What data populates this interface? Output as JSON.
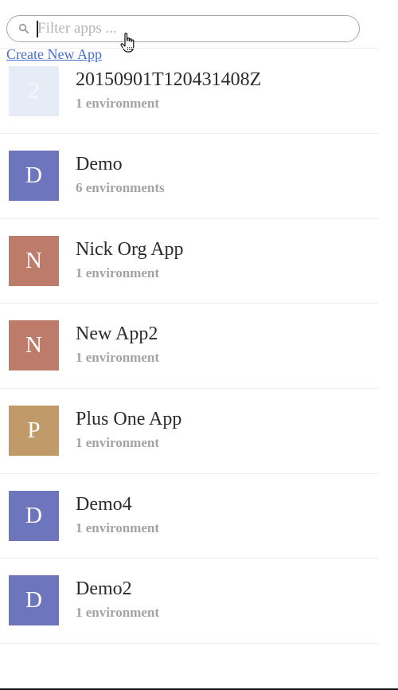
{
  "search": {
    "placeholder": "Filter apps ...",
    "value": ""
  },
  "create_link": "Create New App",
  "apps": [
    {
      "letter": "2",
      "name": "20150901T120431408Z",
      "env": "1 environment",
      "color": "#e6ecf5",
      "faded": true
    },
    {
      "letter": "D",
      "name": "Demo",
      "env": "6 environments",
      "color": "#6d75bd"
    },
    {
      "letter": "N",
      "name": "Nick Org App",
      "env": "1 environment",
      "color": "#bd7b6a"
    },
    {
      "letter": "N",
      "name": "New App2",
      "env": "1 environment",
      "color": "#bd7b6a"
    },
    {
      "letter": "P",
      "name": "Plus One App",
      "env": "1 environment",
      "color": "#c09a68"
    },
    {
      "letter": "D",
      "name": "Demo4",
      "env": "1 environment",
      "color": "#6d75bd"
    },
    {
      "letter": "D",
      "name": "Demo2",
      "env": "1 environment",
      "color": "#6d75bd"
    }
  ],
  "icons": {
    "search": "search-icon",
    "cursor": "hand-pointer-icon"
  }
}
